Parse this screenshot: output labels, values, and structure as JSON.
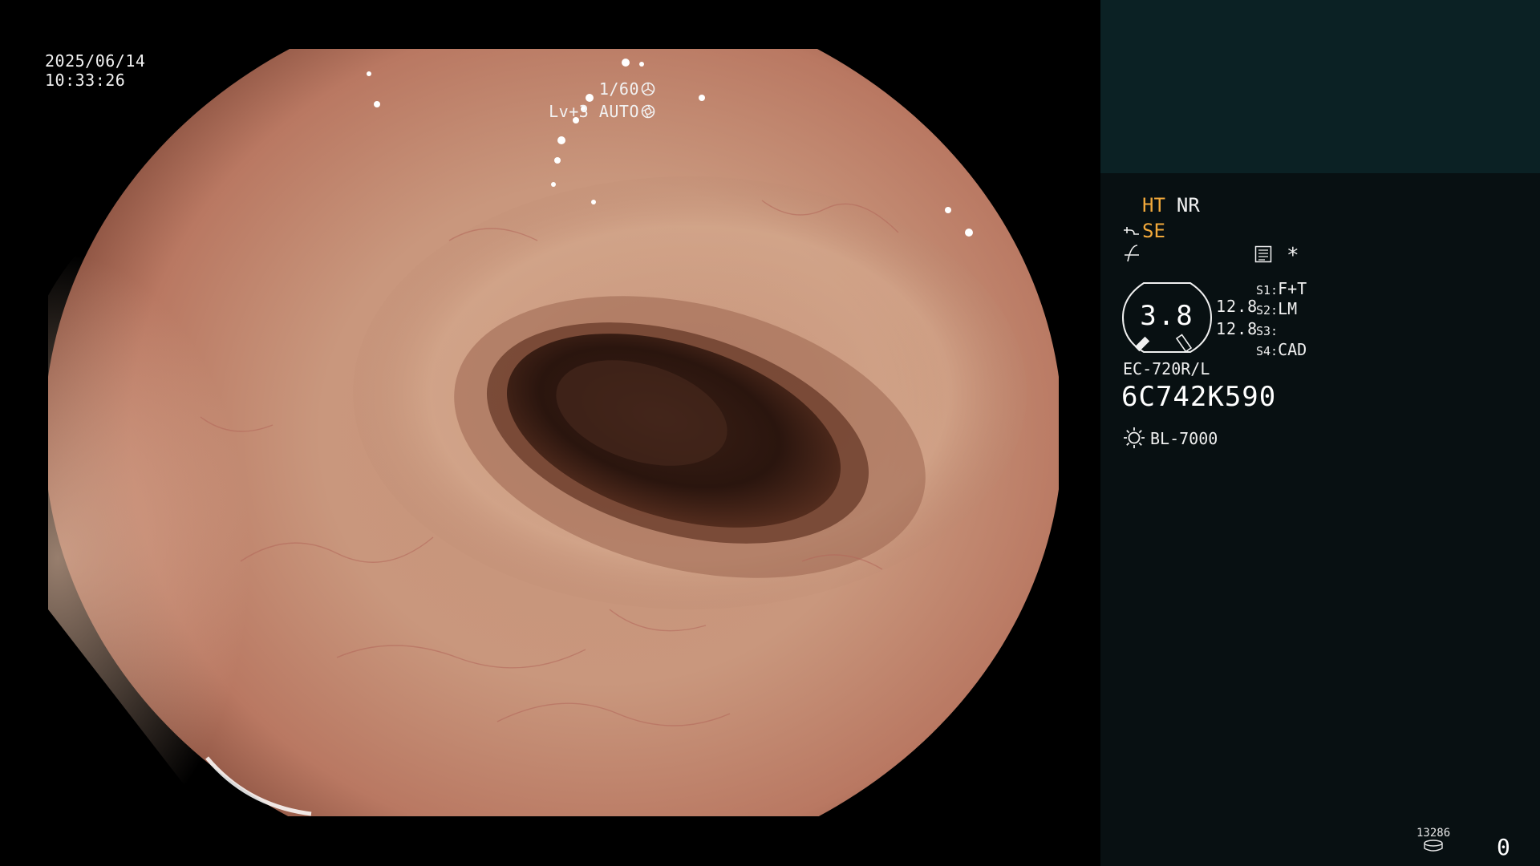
{
  "overlay": {
    "date": "2025/06/14",
    "time": "10:33:26",
    "shutter": "1/60",
    "shutter_icon": "shutter-icon",
    "level": "Lv+3",
    "exposure_mode": "AUTO",
    "exposure_icon": "iris-icon"
  },
  "panel": {
    "ht": "HT",
    "nr": "NR",
    "se": "SE",
    "star": "*",
    "zoom": "3.8",
    "value_a": "12.8",
    "value_b": "12.8",
    "switches": [
      {
        "key": "S1:",
        "value": "F+T"
      },
      {
        "key": "S2:",
        "value": "LM"
      },
      {
        "key": "S3:",
        "value": ""
      },
      {
        "key": "S4:",
        "value": "CAD"
      }
    ],
    "scope_model": "EC-720R/L",
    "scope_serial": "6C742K590",
    "light_source": "BL-7000",
    "light_icon": "light-source-icon",
    "image_count": "13286",
    "image_index": "0"
  },
  "colors": {
    "panel_bg": "#081012",
    "panel_top_bg": "#0b2124",
    "accent_orange": "#f2a93b",
    "text": "#f0f0f0"
  }
}
